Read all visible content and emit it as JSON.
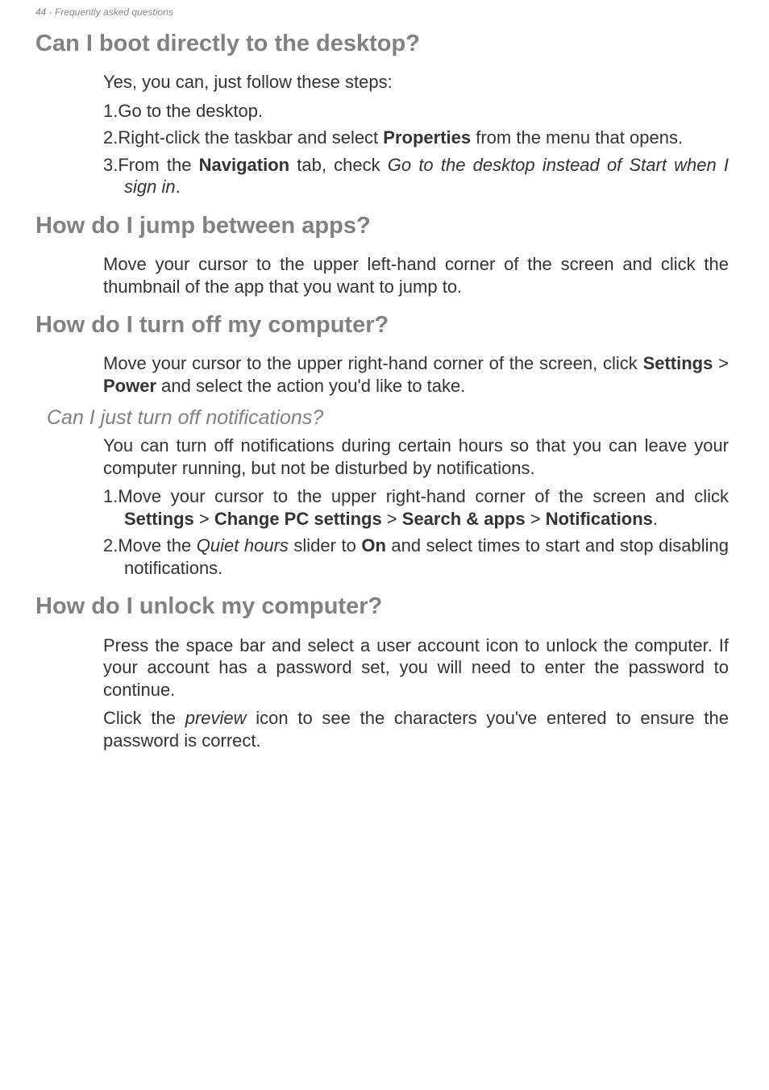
{
  "header": "44 - Frequently asked questions",
  "s1": {
    "heading": "Can I boot directly to the desktop?",
    "intro": "Yes, you can, just follow these steps:",
    "li1_num": "1.",
    "li1_text": "Go to the desktop.",
    "li2_num": "2.",
    "li2_a": "Right-click the taskbar and select ",
    "li2_b": "Properties",
    "li2_c": " from the menu that opens.",
    "li3_num": "3.",
    "li3_a": "From the ",
    "li3_b": "Navigation",
    "li3_c": " tab, check ",
    "li3_d": "Go to the desktop instead of Start when I sign in",
    "li3_e": "."
  },
  "s2": {
    "heading": "How do I jump between apps?",
    "p1": "Move your cursor to the upper left-hand corner of the screen and click the thumbnail of the app that you want to jump to."
  },
  "s3": {
    "heading": "How do I turn off my computer?",
    "p1_a": "Move your cursor to the upper right-hand corner of the screen, click ",
    "p1_b": "Settings",
    "p1_c": " > ",
    "p1_d": "Power",
    "p1_e": " and select the action you'd like to take.",
    "sub_heading": "Can I just turn off notifications?",
    "p2": "You can turn off notifications during certain hours so that you can leave your computer running, but not be disturbed by notifications.",
    "li1_num": "1.",
    "li1_a": "Move your cursor to the upper right-hand corner of the screen and click ",
    "li1_b": "Settings",
    "li1_c": " > ",
    "li1_d": "Change PC settings",
    "li1_e": " > ",
    "li1_f": "Search & apps",
    "li1_g": " > ",
    "li1_h": "Notifications",
    "li1_i": ".",
    "li2_num": "2.",
    "li2_a": "Move the ",
    "li2_b": "Quiet hours",
    "li2_c": " slider to ",
    "li2_d": "On",
    "li2_e": " and select times to start and stop disabling notifications."
  },
  "s4": {
    "heading": "How do I unlock my computer?",
    "p1": "Press the space bar and select a user account icon to unlock the computer. If your account has a password set, you will need to enter the password to continue.",
    "p2_a": "Click the ",
    "p2_b": "preview",
    "p2_c": " icon to see the characters you've entered to ensure the password is correct."
  }
}
